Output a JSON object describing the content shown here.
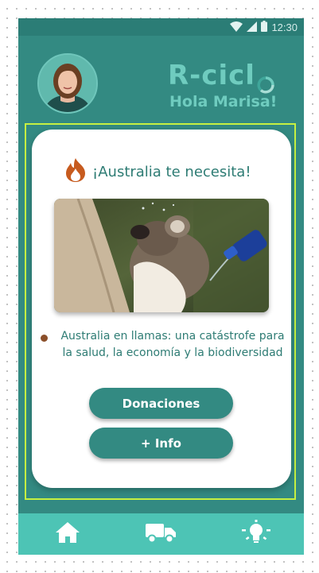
{
  "status_bar": {
    "time": "12:30",
    "icons": [
      "wifi-icon",
      "cellular-signal-icon",
      "battery-icon"
    ],
    "background": "#2b7d76"
  },
  "header": {
    "logo_text": "R-cicl",
    "greeting": "Hola Marisa!",
    "logo_color": "#6fccbf"
  },
  "card": {
    "title": "¡Australia te necesita!",
    "title_icon": "fire-icon",
    "image_alt": "Koala bebiendo agua de una botella",
    "news_text": "Australia en llamas: una catástrofe para la salud, la economía y la biodiversidad",
    "buttons": {
      "donate_label": "Donaciones",
      "info_label": "+ Info"
    }
  },
  "bottom_nav": {
    "items": [
      {
        "icon": "home-icon"
      },
      {
        "icon": "truck-icon"
      },
      {
        "icon": "lightbulb-icon"
      }
    ],
    "background": "#4dc4b5"
  },
  "colors": {
    "app_background": "#338a82",
    "accent": "#6fccbf",
    "selection_outline": "#c6f041",
    "fire": "#c75b1f"
  }
}
